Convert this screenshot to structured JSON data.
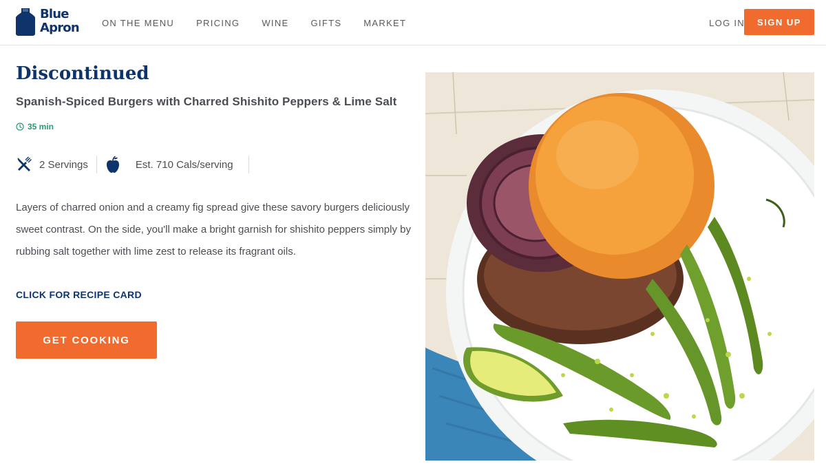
{
  "brand": {
    "logo_line1": "Blue",
    "logo_line2": "Apron",
    "color": "#0f346c",
    "accent": "#f26b2e"
  },
  "nav": {
    "items": [
      {
        "label": "ON THE MENU"
      },
      {
        "label": "PRICING"
      },
      {
        "label": "WINE"
      },
      {
        "label": "GIFTS"
      },
      {
        "label": "MARKET"
      }
    ],
    "login_label": "LOG IN",
    "signup_label": "SIGN UP"
  },
  "recipe": {
    "status": "Discontinued",
    "title": "Spanish-Spiced Burgers with Charred Shishito Peppers & Lime Salt",
    "time": "35 min",
    "servings": "2 Servings",
    "calories": "Est. 710 Cals/serving",
    "description": "Layers of charred onion and a creamy fig spread give these savory burgers deliciously sweet contrast. On the side, you'll make a bright garnish for shishito peppers simply by rubbing salt together with lime zest to release its fragrant oils.",
    "recipe_card_label": "CLICK FOR RECIPE CARD",
    "cta_label": "GET COOKING",
    "icons": {
      "time": "clock-icon",
      "servings": "utensils-icon",
      "calories": "apple-icon"
    }
  }
}
